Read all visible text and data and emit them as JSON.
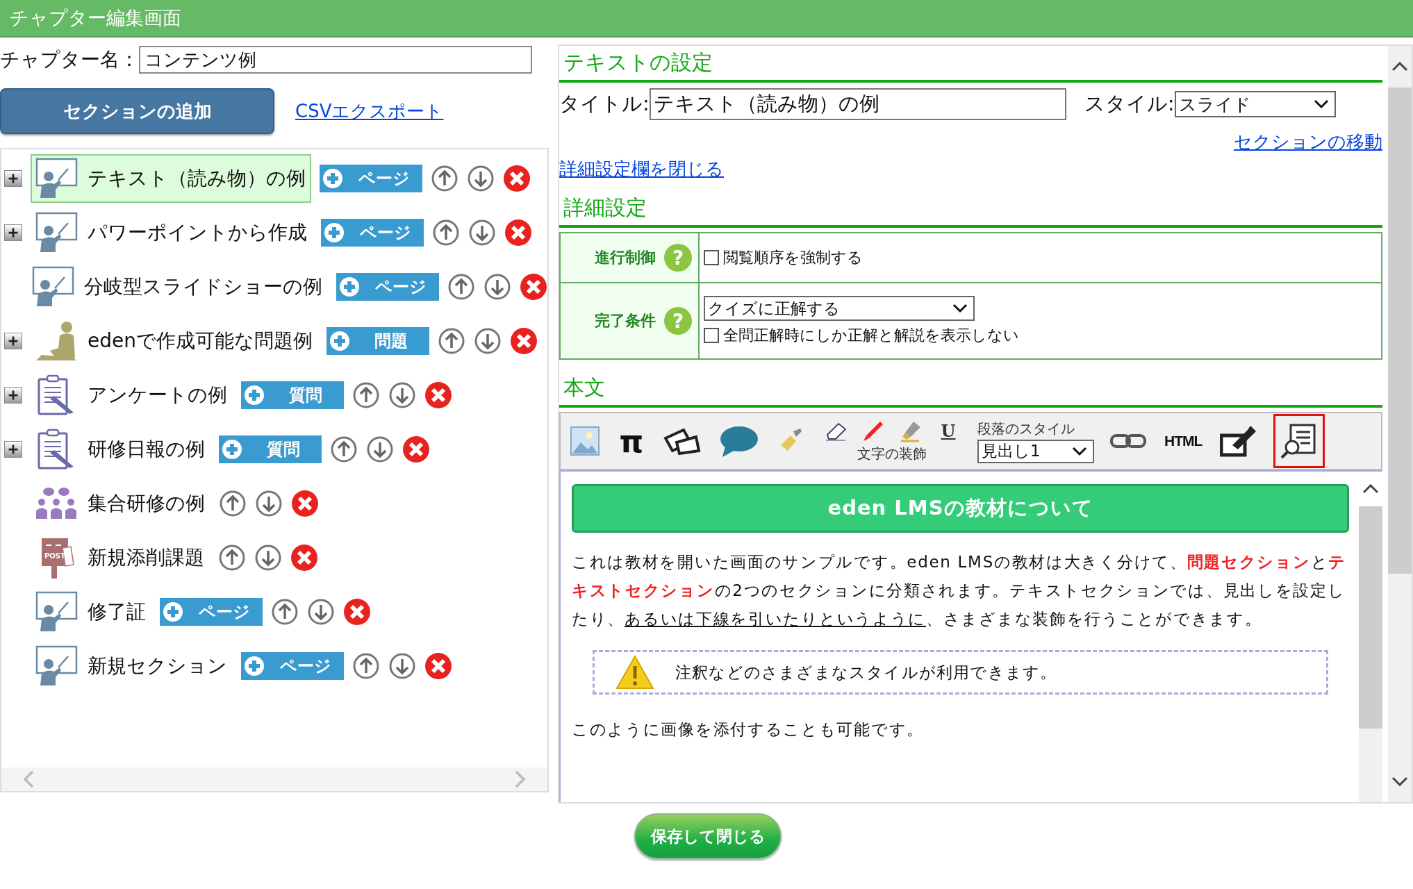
{
  "window": {
    "title": "チャプター編集画面"
  },
  "chapter": {
    "label": "チャプター名：",
    "value": "コンテンツ例"
  },
  "add_section_button": "セクションの追加",
  "csv_link": "CSVエクスポート",
  "sections": [
    {
      "title": "テキスト（読み物）の例",
      "kind": "slide",
      "expandable": true,
      "selected": true,
      "add_button": "ページ"
    },
    {
      "title": "パワーポイントから作成",
      "kind": "slide",
      "expandable": true,
      "selected": false,
      "add_button": "ページ"
    },
    {
      "title": "分岐型スライドショーの例",
      "kind": "slide",
      "expandable": false,
      "selected": false,
      "add_button": "ページ"
    },
    {
      "title": "edenで作成可能な問題例",
      "kind": "quiz",
      "expandable": true,
      "selected": false,
      "add_button": "問題"
    },
    {
      "title": "アンケートの例",
      "kind": "survey",
      "expandable": true,
      "selected": false,
      "add_button": "質問"
    },
    {
      "title": "研修日報の例",
      "kind": "survey",
      "expandable": true,
      "selected": false,
      "add_button": "質問"
    },
    {
      "title": "集合研修の例",
      "kind": "group",
      "expandable": false,
      "selected": false
    },
    {
      "title": "新規添削課題",
      "kind": "post",
      "expandable": false,
      "selected": false,
      "icon_label": "POST"
    },
    {
      "title": "修了証",
      "kind": "slide",
      "expandable": false,
      "selected": false,
      "add_button": "ページ"
    },
    {
      "title": "新規セクション",
      "kind": "slide",
      "expandable": false,
      "selected": false,
      "add_button": "ページ"
    }
  ],
  "text_settings": {
    "heading": "テキストの設定",
    "title_label": "タイトル:",
    "title_value": "テキスト（読み物）の例",
    "style_label": "スタイル:",
    "style_value": "スライド",
    "move_link": "セクションの移動",
    "close_link": "詳細設定欄を閉じる"
  },
  "details": {
    "heading": "詳細設定",
    "rows": [
      {
        "label": "進行制御",
        "help": "?",
        "select_value": null,
        "checkbox": {
          "label": "閲覧順序を強制する",
          "checked": false
        }
      },
      {
        "label": "完了条件",
        "help": "?",
        "select_value": "クイズに正解する",
        "checkbox": {
          "label": "全問正解時にしか正解と解説を表示しない",
          "checked": false
        }
      }
    ]
  },
  "body": {
    "heading": "本文",
    "toolbar": {
      "tools_left": [
        {
          "kind": "image",
          "selected": false
        },
        {
          "kind": "formula",
          "label": "π",
          "selected": false
        },
        {
          "kind": "shapes",
          "selected": false
        },
        {
          "kind": "balloon",
          "selected": false
        },
        {
          "kind": "brush",
          "selected": false
        }
      ],
      "decoration": {
        "label": "文字の装飾",
        "tools": [
          {
            "kind": "eraser",
            "selected": false
          },
          {
            "kind": "pen",
            "selected": false
          },
          {
            "kind": "marker",
            "selected": false
          },
          {
            "kind": "underline",
            "label": "U",
            "selected": false
          }
        ]
      },
      "paragraph_style": {
        "label": "段落のスタイル",
        "value": "見出し1"
      },
      "tools_right": [
        {
          "kind": "link",
          "selected": false
        },
        {
          "kind": "html",
          "label": "HTML",
          "selected": false
        },
        {
          "kind": "insert",
          "selected": false
        },
        {
          "kind": "preview",
          "selected": true
        }
      ]
    },
    "banner": "eden LMSの教材について",
    "paragraph": [
      {
        "text": "これは教材を開いた画面のサンプルです。eden LMSの教材は大きく分けて、",
        "kind": "plain"
      },
      {
        "text": "問題セクション",
        "kind": "highlight"
      },
      {
        "text": "と",
        "kind": "plain"
      },
      {
        "text": "テキストセクション",
        "kind": "highlight"
      },
      {
        "text": "の2つのセクションに分類されます。テキストセクションでは、見出しを設定したり、",
        "kind": "plain"
      },
      {
        "text": "あるいは下線を引いたりというように",
        "kind": "underline"
      },
      {
        "text": "、さまざまな装飾を行うことができます。",
        "kind": "plain"
      }
    ],
    "note": "注釈などのさまざまなスタイルが利用できます。",
    "closing": "このように画像を添付することも可能です。"
  },
  "save_button": "保存して閉じる"
}
